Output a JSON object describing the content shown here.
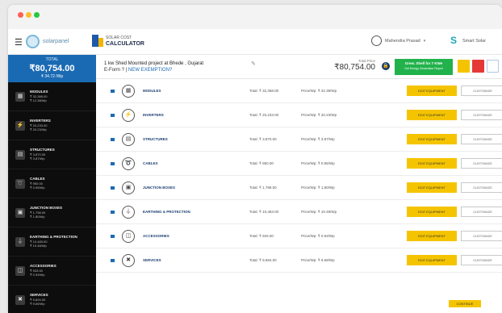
{
  "window": {
    "controls": [
      "close",
      "minimize",
      "maximize"
    ]
  },
  "header": {
    "menu_icon": "hamburger-icon",
    "logo1_text": "solarpanel",
    "logo2_small": "SOLAR COST",
    "logo2_big": "CALCULATOR",
    "user_name": "Mahendra Prasad",
    "brand2_text": "Smart Solar"
  },
  "sidebar": {
    "total_label": "TOTAL",
    "total_value": "₹80,754.00",
    "total_monthly": "₹ 34.72 /Wp",
    "items": [
      {
        "name": "MODULES",
        "t1": "₹ 32,368.00",
        "t2": "₹ 12.38/Wp"
      },
      {
        "name": "INVERTERS",
        "t1": "₹ 20,233.00",
        "t2": "₹ 20.23/Wp"
      },
      {
        "name": "STRUCTURES",
        "t1": "₹ 3,870.00",
        "t2": "₹ 3.87/Wp"
      },
      {
        "name": "CABLES",
        "t1": "₹ 950.00",
        "t2": "₹ 0.95/Wp"
      },
      {
        "name": "JUNCTION BOXES",
        "t1": "₹ 1,798.00",
        "t2": "₹ 1.80/Wp"
      },
      {
        "name": "EARTHING & PROTECTION",
        "t1": "₹ 10,483.00",
        "t2": "₹ 10.48/Wp"
      },
      {
        "name": "ACCESSORIES",
        "t1": "₹ 933.00",
        "t2": "₹ 0.93/Wp"
      },
      {
        "name": "SERVICES",
        "t1": "₹ 9,694.00",
        "t2": "₹ 9.69/Wp"
      }
    ]
  },
  "project": {
    "title_line1": "1 kw Shed Mounted project at Bhede , Gujarat",
    "title_line2_prefix": "E-Form ? |",
    "title_line2_link": "NEW EXEMPTION?",
    "total_label": "Total Price",
    "total_value": "₹80,754.00",
    "green_btn_line1": "Grew. Shell for 7 KWe",
    "green_btn_line2": "Get Energy Generation Report"
  },
  "rows": [
    {
      "icon": "▦",
      "name": "MODULES",
      "total": "Total: ₹ 32,368.00",
      "monthly": "Price/Wp: ₹ 32.39/Wp",
      "btn1": "EDIT EQUIPMENT",
      "btn2": "CUSTOMIZE"
    },
    {
      "icon": "⚡",
      "name": "INVERTERS",
      "total": "Total: ₹ 20,233.00",
      "monthly": "Price/Wp: ₹ 20.23/Wp",
      "btn1": "EDIT EQUIPMENT",
      "btn2": "CUSTOMIZE"
    },
    {
      "icon": "▤",
      "name": "STRUCTURES",
      "total": "Total: ₹ 3,870.00",
      "monthly": "Price/Wp: ₹ 3.87/Wp",
      "btn1": "EDIT EQUIPMENT",
      "btn2": "CUSTOMIZE"
    },
    {
      "icon": "➰",
      "name": "CABLES",
      "total": "Total: ₹ 950.00",
      "monthly": "Price/Wp: ₹ 0.95/Wp",
      "btn1": "EDIT EQUIPMENT",
      "btn2": "CUSTOMIZE"
    },
    {
      "icon": "▣",
      "name": "JUNCTION BOXES",
      "total": "Total: ₹ 1,798.00",
      "monthly": "Price/Wp: ₹ 1.80/Wp",
      "btn1": "EDIT EQUIPMENT",
      "btn2": "CUSTOMIZE"
    },
    {
      "icon": "⏚",
      "name": "EARTHING & PROTECTION",
      "total": "Total: ₹ 10,483.00",
      "monthly": "Price/Wp: ₹ 10.48/Wp",
      "btn1": "EDIT EQUIPMENT",
      "btn2": "CUSTOMIZE"
    },
    {
      "icon": "◫",
      "name": "ACCESSORIES",
      "total": "Total: ₹ 933.00",
      "monthly": "Price/Wp: ₹ 0.93/Wp",
      "btn1": "EDIT EQUIPMENT",
      "btn2": "CUSTOMIZE"
    },
    {
      "icon": "✖",
      "name": "SERVICES",
      "total": "Total: ₹ 9,694.00",
      "monthly": "Price/Wp: ₹ 9.69/Wp",
      "btn1": "EDIT EQUIPMENT",
      "btn2": "CUSTOMIZE"
    }
  ],
  "footer": {
    "button": "CONTINUE"
  }
}
